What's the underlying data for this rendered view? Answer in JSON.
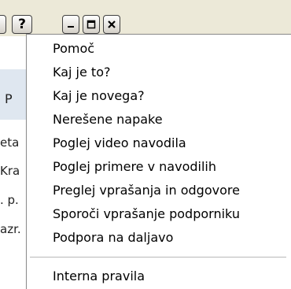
{
  "titlebar": {
    "help_label": "?",
    "buttons": [
      "minimize",
      "maximize",
      "close"
    ]
  },
  "background": {
    "partial_texts": [
      "P",
      "eta",
      "Kra",
      ". p.",
      "azr."
    ]
  },
  "menu": {
    "items": [
      "Pomoč",
      "Kaj je to?",
      "Kaj je novega?",
      "Nerešene napake",
      "Poglej video navodila",
      "Poglej primere v navodilih",
      "Preglej vprašanja in odgovore",
      "Sporoči vprašanje podporniku",
      "Podpora na daljavo",
      "Interna pravila"
    ]
  }
}
